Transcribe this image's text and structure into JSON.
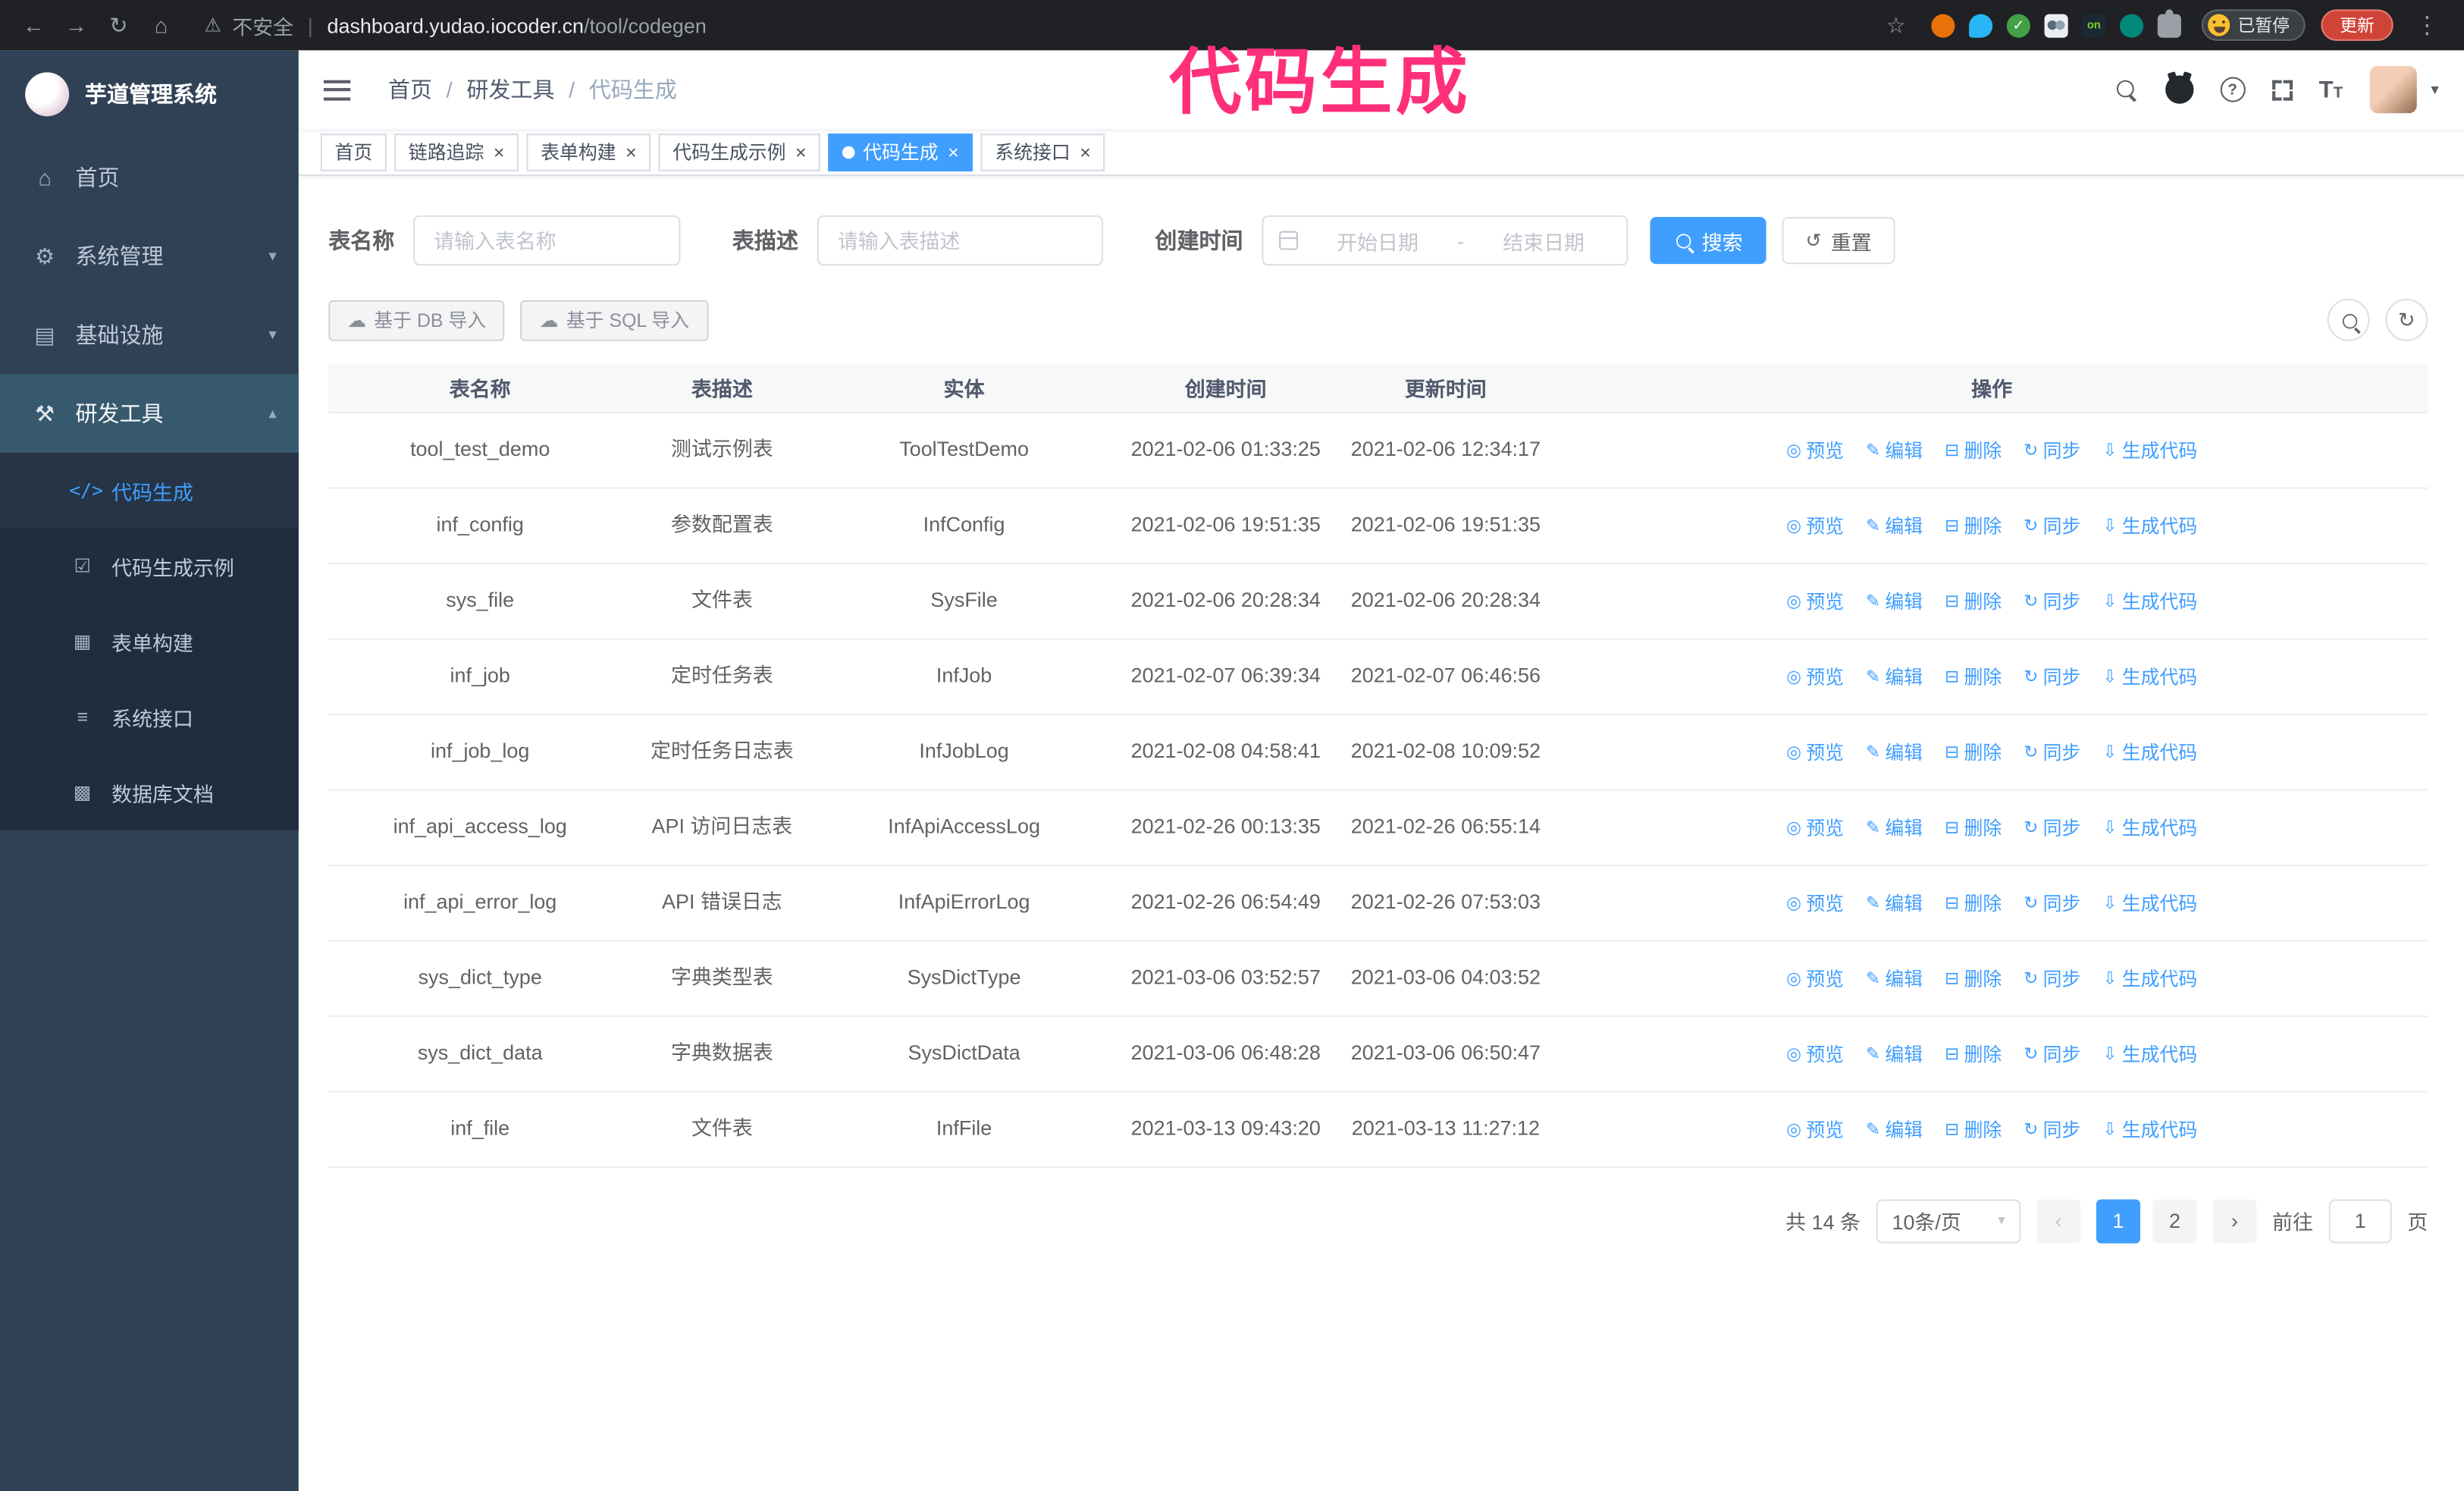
{
  "overlay": {
    "text": "代码生成"
  },
  "browser": {
    "security_warning": "不安全",
    "url_separator": "|",
    "url_host": "dashboard.yudao.iocoder.cn",
    "url_path": "/tool/codegen",
    "paused_badge": "已暂停",
    "update_button": "更新"
  },
  "icons": {
    "back": "←",
    "forward": "→",
    "reload": "↻",
    "home": "⌂",
    "warning": "⚠",
    "star": "☆",
    "menu_dots": "⋮",
    "ext_check": "✓",
    "ext_on": "on",
    "chevron-down": "▾",
    "chevron-up": "▴",
    "caret-down": "▾",
    "home-icon": "⌂",
    "gear-icon": "⚙",
    "infra-icon": "▤",
    "tools-icon": "⚒",
    "code-icon": "</>",
    "example-icon": "☑",
    "form-icon": "▦",
    "api-icon": "≡",
    "db-doc-icon": "▩",
    "cloud": "☁",
    "refresh": "↻",
    "reset": "↺",
    "eye-icon": "◎",
    "edit-icon": "✎",
    "delete-icon": "⊟",
    "sync-icon": "↻",
    "download-icon": "⇩",
    "prev": "‹",
    "next": "›",
    "date-sep": "-"
  },
  "sidebar": {
    "app_title": "芋道管理系统",
    "items": [
      {
        "label": "首页",
        "icon": "home-icon"
      },
      {
        "label": "系统管理",
        "icon": "gear-icon",
        "chevron": "down"
      },
      {
        "label": "基础设施",
        "icon": "infra-icon",
        "chevron": "down"
      },
      {
        "label": "研发工具",
        "icon": "tools-icon",
        "chevron": "up",
        "open": true
      }
    ],
    "submenu": [
      {
        "label": "代码生成",
        "icon": "code-icon",
        "active": true
      },
      {
        "label": "代码生成示例",
        "icon": "example-icon"
      },
      {
        "label": "表单构建",
        "icon": "form-icon"
      },
      {
        "label": "系统接口",
        "icon": "api-icon"
      },
      {
        "label": "数据库文档",
        "icon": "db-doc-icon"
      }
    ]
  },
  "navbar": {
    "breadcrumb": [
      "首页",
      "研发工具",
      "代码生成"
    ],
    "breadcrumb_separator": "/"
  },
  "tabs": [
    {
      "label": "首页",
      "closable": false,
      "active": false
    },
    {
      "label": "链路追踪",
      "closable": true,
      "active": false
    },
    {
      "label": "表单构建",
      "closable": true,
      "active": false
    },
    {
      "label": "代码生成示例",
      "closable": true,
      "active": false
    },
    {
      "label": "代码生成",
      "closable": true,
      "active": true
    },
    {
      "label": "系统接口",
      "closable": true,
      "active": false
    }
  ],
  "filters": {
    "table_name_label": "表名称",
    "table_name_placeholder": "请输入表名称",
    "table_desc_label": "表描述",
    "table_desc_placeholder": "请输入表描述",
    "create_time_label": "创建时间",
    "start_date_placeholder": "开始日期",
    "end_date_placeholder": "结束日期",
    "search_button": "搜索",
    "reset_button": "重置"
  },
  "toolbar": {
    "import_db_button": "基于 DB 导入",
    "import_sql_button": "基于 SQL 导入"
  },
  "table": {
    "columns": [
      "表名称",
      "表描述",
      "实体",
      "创建时间",
      "更新时间",
      "操作"
    ],
    "actions": [
      "预览",
      "编辑",
      "删除",
      "同步",
      "生成代码"
    ],
    "rows": [
      {
        "name": "tool_test_demo",
        "desc": "测试示例表",
        "entity": "ToolTestDemo",
        "created": "2021-02-06 01:33:25",
        "updated": "2021-02-06 12:34:17"
      },
      {
        "name": "inf_config",
        "desc": "参数配置表",
        "entity": "InfConfig",
        "created": "2021-02-06 19:51:35",
        "updated": "2021-02-06 19:51:35"
      },
      {
        "name": "sys_file",
        "desc": "文件表",
        "entity": "SysFile",
        "created": "2021-02-06 20:28:34",
        "updated": "2021-02-06 20:28:34"
      },
      {
        "name": "inf_job",
        "desc": "定时任务表",
        "entity": "InfJob",
        "created": "2021-02-07 06:39:34",
        "updated": "2021-02-07 06:46:56"
      },
      {
        "name": "inf_job_log",
        "desc": "定时任务日志表",
        "entity": "InfJobLog",
        "created": "2021-02-08 04:58:41",
        "updated": "2021-02-08 10:09:52"
      },
      {
        "name": "inf_api_access_log",
        "desc": "API 访问日志表",
        "entity": "InfApiAccessLog",
        "created": "2021-02-26 00:13:35",
        "updated": "2021-02-26 06:55:14"
      },
      {
        "name": "inf_api_error_log",
        "desc": "API 错误日志",
        "entity": "InfApiErrorLog",
        "created": "2021-02-26 06:54:49",
        "updated": "2021-02-26 07:53:03"
      },
      {
        "name": "sys_dict_type",
        "desc": "字典类型表",
        "entity": "SysDictType",
        "created": "2021-03-06 03:52:57",
        "updated": "2021-03-06 04:03:52"
      },
      {
        "name": "sys_dict_data",
        "desc": "字典数据表",
        "entity": "SysDictData",
        "created": "2021-03-06 06:48:28",
        "updated": "2021-03-06 06:50:47"
      },
      {
        "name": "inf_file",
        "desc": "文件表",
        "entity": "InfFile",
        "created": "2021-03-13 09:43:20",
        "updated": "2021-03-13 11:27:12"
      }
    ]
  },
  "pagination": {
    "total": "共 14 条",
    "page_size": "10条/页",
    "pages": [
      "1",
      "2"
    ],
    "current_page": "1",
    "goto_label": "前往",
    "goto_value": "1",
    "page_suffix": "页"
  },
  "colors": {
    "accent": "#409eff",
    "sidebar_bg": "#304156",
    "overlay_pink": "#ff2f7a"
  }
}
